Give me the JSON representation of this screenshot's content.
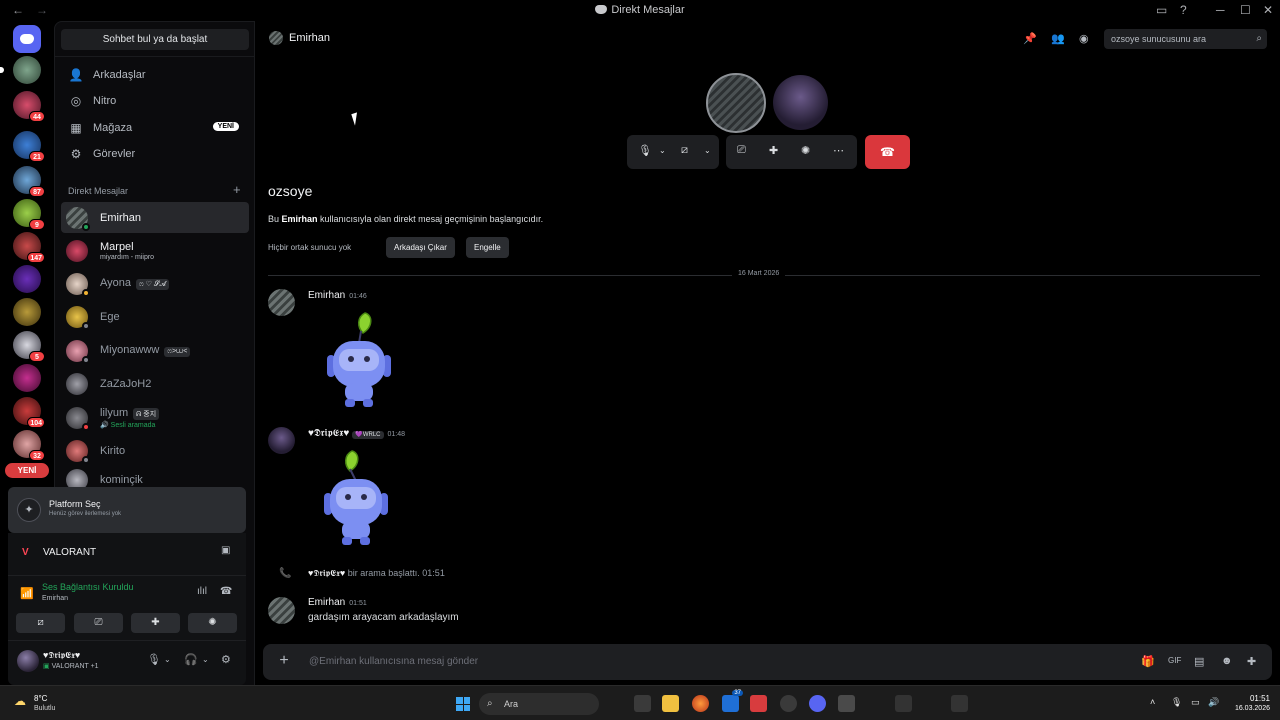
{
  "window": {
    "title": "Direkt Mesajlar"
  },
  "sidebar": {
    "search_label": "Sohbet bul ya da başlat",
    "nav": [
      {
        "label": "Arkadaşlar",
        "icon": "friends-icon"
      },
      {
        "label": "Nitro",
        "icon": "nitro-icon"
      },
      {
        "label": "Mağaza",
        "icon": "shop-icon",
        "badge": "YENİ"
      },
      {
        "label": "Görevler",
        "icon": "quests-icon"
      }
    ],
    "dm_header": "Direkt Mesajlar",
    "dms": [
      {
        "name": "Emirhan",
        "active": true,
        "status": "online"
      },
      {
        "name": "Marpel",
        "sub": "miyardım - miipro",
        "status": "none"
      },
      {
        "name": "Ayona",
        "tag": "ෆ ♡ 𝓢𝓐",
        "status": "idle"
      },
      {
        "name": "Ege",
        "status": "offline"
      },
      {
        "name": "Miyonawww",
        "tag": "ෆ>⩊<",
        "status": "offline"
      },
      {
        "name": "ZaZaJoH2",
        "status": "none"
      },
      {
        "name": "lilyum",
        "tag": "ᕱ 중지",
        "sub": "Sesli aramada",
        "status": "dnd"
      },
      {
        "name": "Kirito",
        "status": "offline"
      },
      {
        "name": "kominçik",
        "status": "offline"
      }
    ],
    "new_badge": "YENİ"
  },
  "server_badges": [
    "44",
    "21",
    "87",
    "9",
    "147",
    "5",
    "104",
    "32"
  ],
  "platform": {
    "title": "Platform Seç",
    "subtitle": "Henüz görev ilerlemesi yok"
  },
  "activity": {
    "game": "VALORANT"
  },
  "voice": {
    "status": "Ses Bağlantısı Kuruldu",
    "channel": "Emirhan"
  },
  "user": {
    "name": "♥𝕯𝖗𝖎𝖕𝕰𝖝♥",
    "status": "VALORANT +1"
  },
  "header": {
    "title": "Emirhan",
    "search_placeholder": "ozsoye sunucusunu ara"
  },
  "welcome": {
    "username": "ozsoye",
    "intro_before": "Bu ",
    "intro_name": "Emirhan",
    "intro_after": " kullanıcısıyla olan direkt mesaj geçmişinin başlangıcıdır.",
    "no_common": "Hiçbir ortak sunucu yok",
    "remove_friend": "Arkadaşı Çıkar",
    "block": "Engelle"
  },
  "date_divider": "16 Mart 2026",
  "messages": [
    {
      "author": "Emirhan",
      "time": "01:46",
      "type": "sticker"
    },
    {
      "author": "♥𝕯𝖗𝖎𝖕𝕰𝖝♥",
      "tag": "💜WRLC",
      "time": "01:48",
      "type": "sticker"
    },
    {
      "author": "♥𝕯𝖗𝖎𝖕𝕰𝖝♥",
      "system_text": "bir arama başlattı.",
      "time": "01:51",
      "type": "call"
    },
    {
      "author": "Emirhan",
      "time": "01:51",
      "text": "gardaşım arayacam arkadaşlayım"
    }
  ],
  "composer": {
    "placeholder": "@Emirhan kullanıcısına mesaj gönder"
  },
  "taskbar": {
    "weather_temp": "8°C",
    "weather_desc": "Bulutlu",
    "search": "Ara",
    "time": "01:51",
    "date": "16.03.2026",
    "mail_badge": "37"
  }
}
